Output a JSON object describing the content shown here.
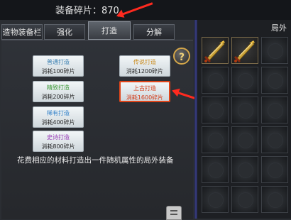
{
  "header": {
    "fragments_text": "装备碎片：870"
  },
  "tabs": [
    {
      "label": "造物装备栏",
      "active": false
    },
    {
      "label": "强化",
      "active": false
    },
    {
      "label": "打造",
      "active": true
    },
    {
      "label": "分解",
      "active": false
    }
  ],
  "craft_buttons": {
    "normal": {
      "title": "普通打造",
      "cost": "消耗100碎片"
    },
    "fine": {
      "title": "精致打造",
      "cost": "消耗200碎片"
    },
    "rare": {
      "title": "稀有打造",
      "cost": "消耗400碎片"
    },
    "epic": {
      "title": "史诗打造",
      "cost": "消耗800碎片"
    },
    "legend": {
      "title": "传说打造",
      "cost": "消耗1200碎片"
    },
    "ancient": {
      "title": "上古打造",
      "cost": "消耗1600碎片"
    }
  },
  "help_label": "?",
  "description": "花费相应的材料打造出一件随机属性的局外装备",
  "inventory": {
    "title": "局外",
    "slots_filled": 2
  },
  "colors": {
    "arrow": "#ff2a1f",
    "ancient_text": "#d63a16",
    "divider": "#3b3f84"
  }
}
